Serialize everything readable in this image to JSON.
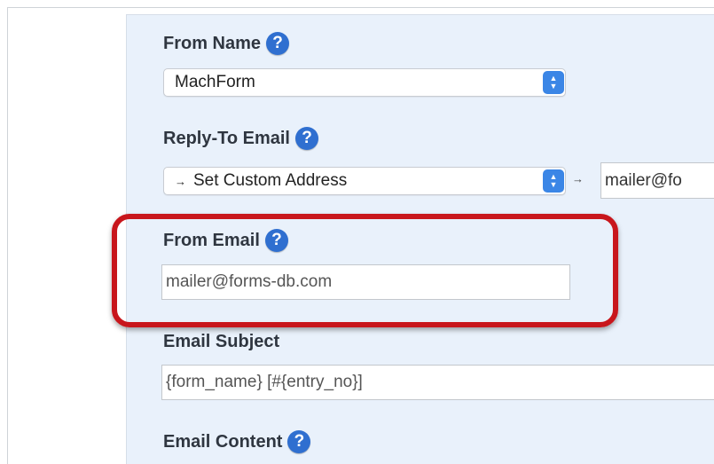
{
  "from_name": {
    "label": "From Name",
    "selected": "MachForm"
  },
  "reply_to": {
    "label": "Reply-To Email",
    "selected": "Set Custom Address",
    "arrow": "→",
    "custom_value": "mailer@fo"
  },
  "from_email": {
    "label": "From Email",
    "value": "mailer@forms-db.com"
  },
  "email_subject": {
    "label": "Email Subject",
    "value": "{form_name} [#{entry_no}]"
  },
  "email_content": {
    "label": "Email Content"
  },
  "help_glyph": "?",
  "colors": {
    "help": "#2f6fd0",
    "highlight": "#c8161c",
    "stepper": "#3b86e6",
    "panel": "#e9f1fb"
  }
}
